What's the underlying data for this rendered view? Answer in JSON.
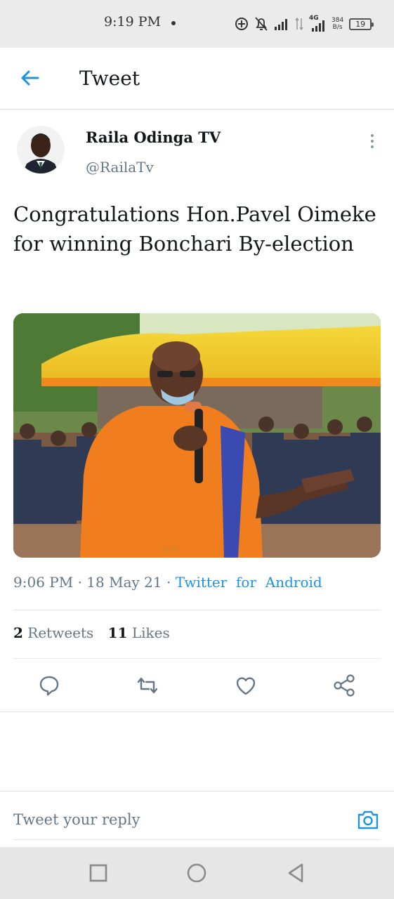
{
  "status_bar": {
    "time": "9:19 PM",
    "network_type": "4G",
    "speed_value": "384",
    "speed_unit": "B/s",
    "battery": "19",
    "icons": [
      "add-circle-icon",
      "notifications-off-icon",
      "signal-icon",
      "data-arrows-icon",
      "signal-4g-icon",
      "battery-icon"
    ]
  },
  "header": {
    "title": "Tweet",
    "back_icon": "back-arrow-icon"
  },
  "tweet": {
    "author_name": "Raila Odinga TV",
    "handle": "@RailaTv",
    "text": "Congratulations Hon.Pavel Oimeke for winning Bonchari By-election",
    "time": "9:06 PM",
    "date": "18 May 21",
    "source": "Twitter  for  Android",
    "retweet_count": "2",
    "retweet_label": "Retweets",
    "like_count": "11",
    "like_label": "Likes",
    "photo_watermark": "GEM"
  },
  "actions": [
    "reply-icon",
    "retweet-icon",
    "like-icon",
    "share-icon"
  ],
  "reply": {
    "placeholder": "Tweet your reply"
  },
  "colors": {
    "accent": "#1b95e0",
    "text": "#14171a",
    "muted": "#657786",
    "status_bar_bg": "#ebebeb",
    "nav_bar_bg": "#e6e6e6"
  },
  "nav_bar": [
    "recent-apps-icon",
    "home-icon",
    "back-icon"
  ]
}
